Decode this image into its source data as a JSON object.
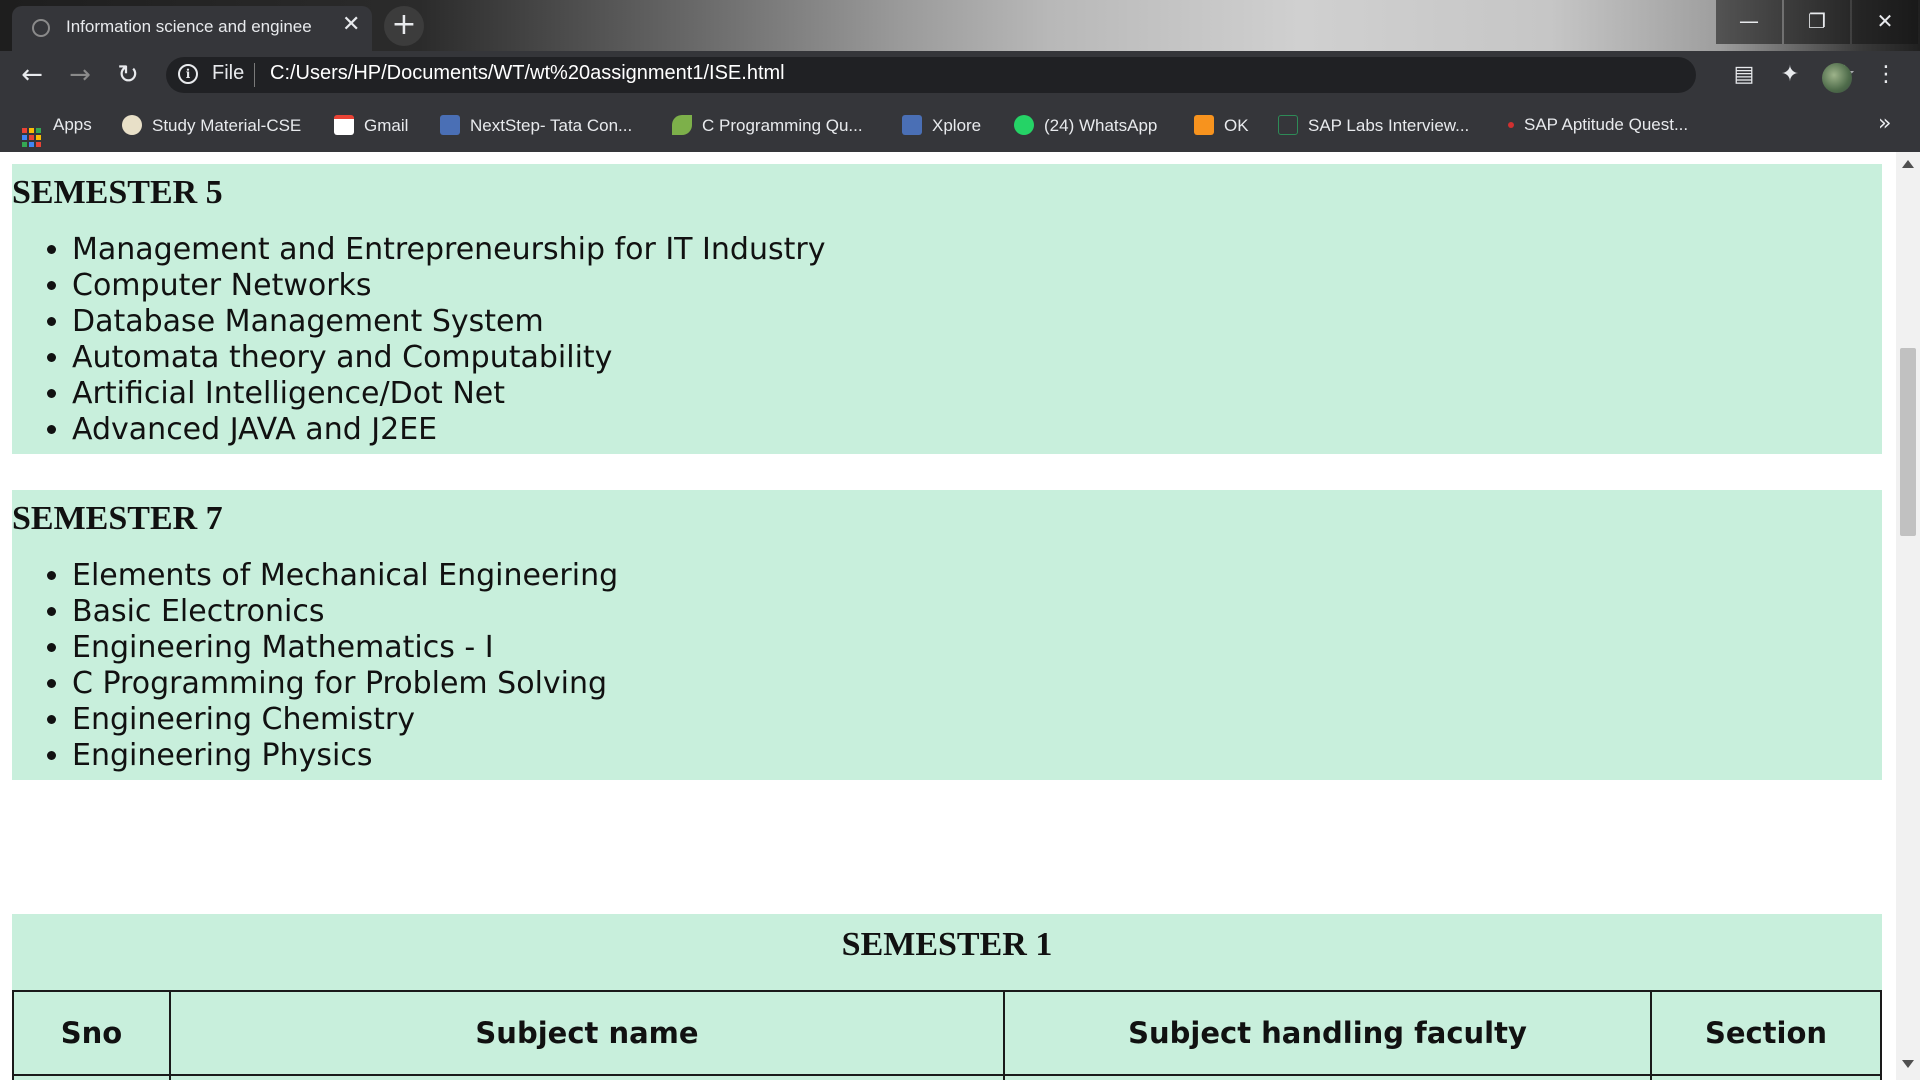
{
  "browser": {
    "tab_title": "Information science and enginee",
    "new_tab": "+",
    "window_controls": {
      "minimize": "—",
      "restore": "❐",
      "close": "✕"
    },
    "address": {
      "scheme_label": "File",
      "url": "C:/Users/HP/Documents/WT/wt%20assignment1/ISE.html"
    },
    "bookmarks": [
      {
        "label": "Apps",
        "icon": "apps-grid-icon"
      },
      {
        "label": "Study Material-CSE",
        "icon": "study-material-icon"
      },
      {
        "label": "Gmail",
        "icon": "gmail-icon"
      },
      {
        "label": "NextStep- Tata Con...",
        "icon": "tata-icon"
      },
      {
        "label": "C Programming Qu...",
        "icon": "leaf-icon"
      },
      {
        "label": "Xplore",
        "icon": "tata-icon"
      },
      {
        "label": "(24) WhatsApp",
        "icon": "whatsapp-icon"
      },
      {
        "label": "OK",
        "icon": "ok-icon"
      },
      {
        "label": "SAP Labs Interview...",
        "icon": "sap-icon"
      },
      {
        "label": "SAP Aptitude Quest...",
        "icon": "dot-icon"
      }
    ],
    "bookmarks_more": "»"
  },
  "page": {
    "semester_5": {
      "heading": "SEMESTER 5",
      "subjects": [
        "Management and Entrepreneurship for IT Industry",
        "Computer Networks",
        "Database Management System",
        "Automata theory and Computability",
        "Artificial Intelligence/Dot Net",
        "Advanced JAVA and J2EE"
      ]
    },
    "semester_7": {
      "heading": "SEMESTER 7",
      "subjects": [
        "Elements of Mechanical Engineering",
        "Basic Electronics",
        "Engineering Mathematics - I",
        "C Programming for Problem Solving",
        "Engineering Chemistry",
        "Engineering Physics"
      ]
    },
    "semester_1_table": {
      "heading": "SEMESTER 1",
      "columns": [
        "Sno",
        "Subject name",
        "Subject handling faculty",
        "Section"
      ]
    }
  },
  "colors": {
    "section_bg": "#c8efdc",
    "chrome_bg": "#35363a",
    "omnibox_bg": "#202124"
  }
}
